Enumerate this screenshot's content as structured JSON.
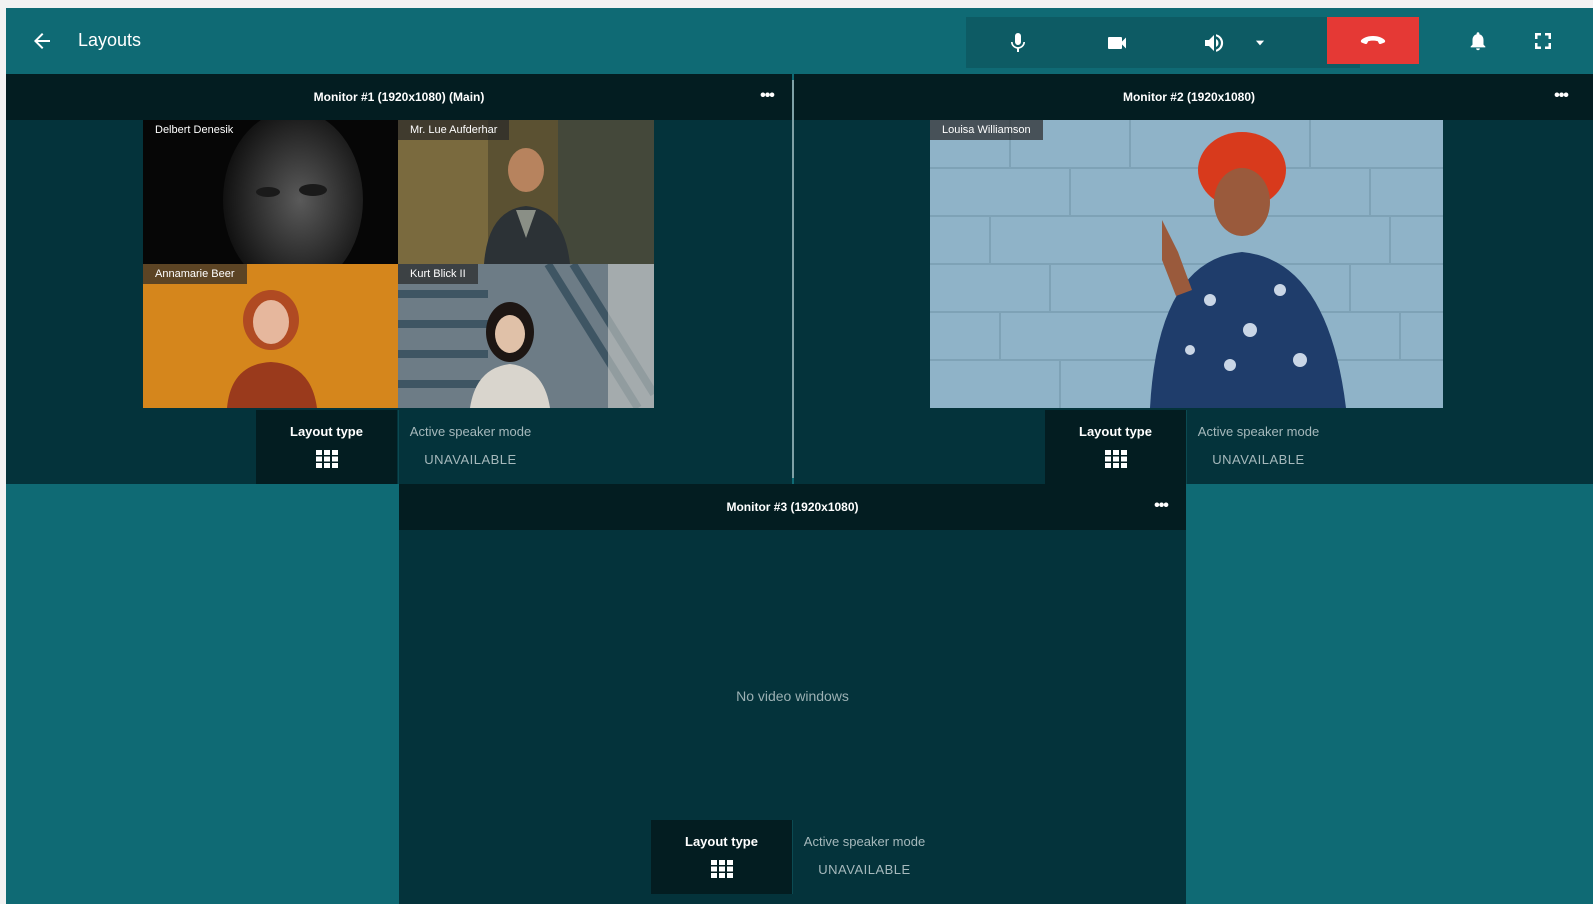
{
  "header": {
    "title": "Layouts",
    "back_icon": "arrow-left-icon",
    "controls": {
      "mic_icon": "microphone-icon",
      "camera_icon": "video-camera-icon",
      "speaker_icon": "volume-icon",
      "speaker_menu_icon": "caret-down-icon",
      "hangup_icon": "phone-hangup-icon",
      "notifications_icon": "bell-icon",
      "fullscreen_icon": "fullscreen-icon"
    },
    "colors": {
      "bar": "#0f6a74",
      "hangup": "#e53935"
    }
  },
  "monitors": [
    {
      "title": "Monitor #1 (1920x1080) (Main)",
      "menu_label": "•••",
      "participants": [
        "Delbert Denesik",
        "Mr. Lue Aufderhar",
        "Annamarie Beer",
        "Kurt Blick II"
      ],
      "layout_type_label": "Layout type",
      "active_speaker_label": "Active speaker mode",
      "active_speaker_value": "UNAVAILABLE"
    },
    {
      "title": "Monitor #2 (1920x1080)",
      "menu_label": "•••",
      "participants": [
        "Louisa Williamson"
      ],
      "layout_type_label": "Layout type",
      "active_speaker_label": "Active speaker mode",
      "active_speaker_value": "UNAVAILABLE"
    },
    {
      "title": "Monitor #3 (1920x1080)",
      "menu_label": "•••",
      "empty_message": "No video windows",
      "layout_type_label": "Layout type",
      "active_speaker_label": "Active speaker mode",
      "active_speaker_value": "UNAVAILABLE"
    }
  ]
}
